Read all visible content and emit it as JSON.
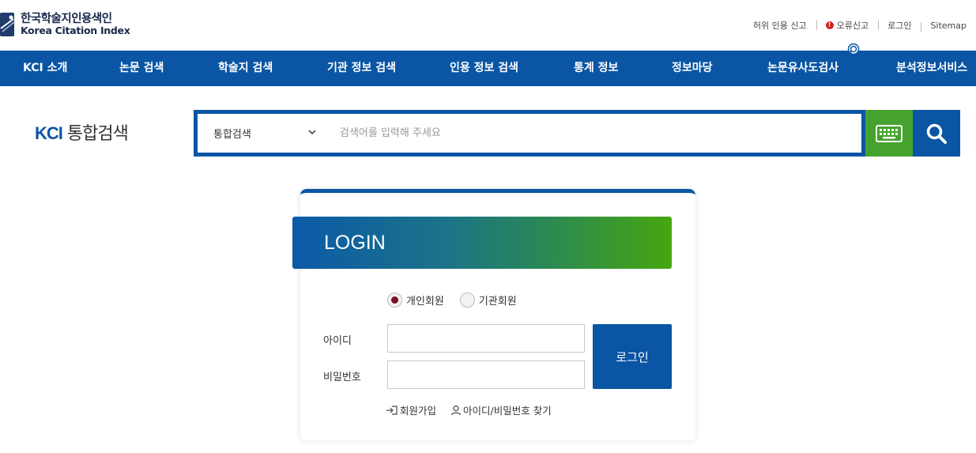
{
  "header": {
    "logo_ko": "한국학술지인용색인",
    "logo_en": "Korea Citation Index",
    "util_links": [
      {
        "label": "허위 인용 신고",
        "icon": ""
      },
      {
        "label": "오류신고",
        "icon": "alert-icon"
      },
      {
        "label": "로그인",
        "icon": ""
      },
      {
        "label": "Sitemap",
        "icon": ""
      }
    ],
    "alert_glyph": "!"
  },
  "nav": {
    "items": [
      "KCI 소개",
      "논문 검색",
      "학술지 검색",
      "기관 정보 검색",
      "인용 정보 검색",
      "통계 정보",
      "정보마당",
      "논문유사도검사",
      "분석정보서비스"
    ]
  },
  "search": {
    "title_kci": "KCI",
    "title_ko": "통합검색",
    "scope": "통합검색",
    "placeholder": "검색어를 입력해 주세요"
  },
  "login": {
    "banner": "LOGIN",
    "member_types": [
      {
        "label": "개인회원",
        "selected": true
      },
      {
        "label": "기관회원",
        "selected": false
      }
    ],
    "id_label": "아이디",
    "pw_label": "비밀번호",
    "submit": "로그인",
    "signup": "회원가입",
    "find": "아이디/비밀번호 찾기"
  },
  "colors": {
    "brand_blue": "#0a55a4",
    "keyboard_green": "#46a22e",
    "radio_selected": "#7a1020"
  }
}
